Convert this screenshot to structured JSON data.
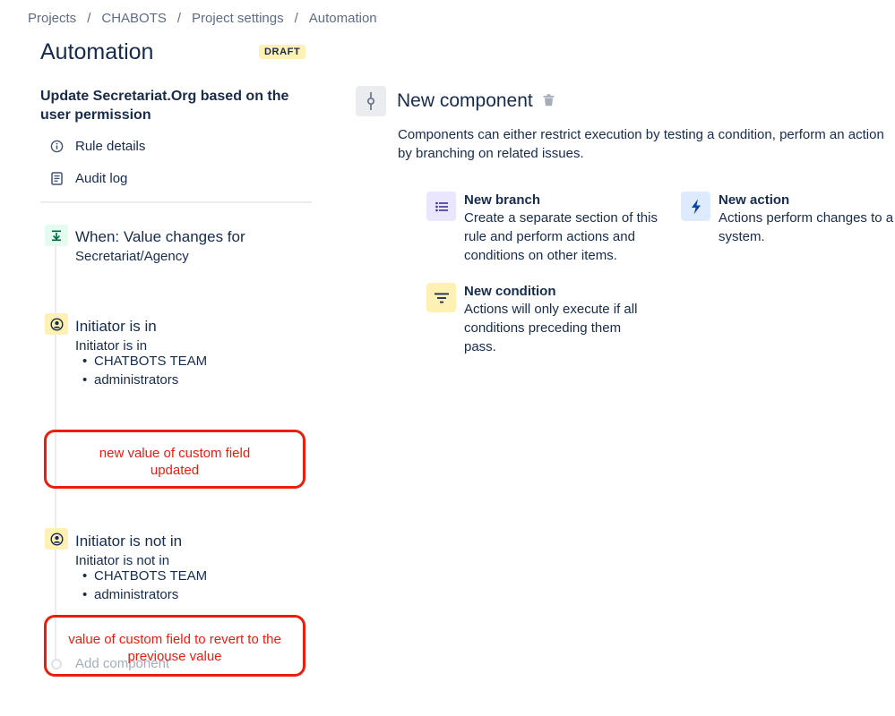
{
  "breadcrumb": [
    "Projects",
    "CHABOTS",
    "Project settings",
    "Automation"
  ],
  "page": {
    "title": "Automation",
    "status_badge": "DRAFT"
  },
  "rule": {
    "name": "Update Secretariat.Org based on the user permission"
  },
  "sidebar_links": [
    {
      "label": "Rule details",
      "icon": "info-icon"
    },
    {
      "label": "Audit log",
      "icon": "document-icon"
    }
  ],
  "steps": {
    "trigger": {
      "title": "When: Value changes for",
      "subtitle": "Secretariat/Agency",
      "icon": "trigger-icon"
    },
    "condition1": {
      "title": "Initiator is in",
      "subtitle": "Initiator is in",
      "items": [
        "CHATBOTS TEAM",
        "administrators"
      ],
      "icon": "user-icon"
    },
    "condition2": {
      "title": "Initiator is not in",
      "subtitle": "Initiator is not in",
      "items": [
        "CHATBOTS TEAM",
        "administrators"
      ],
      "icon": "user-icon"
    }
  },
  "annotations": {
    "first": [
      "new value of custom field",
      "updated"
    ],
    "second": [
      "value of custom field to revert to the",
      "previouse value"
    ]
  },
  "add_component": "Add component",
  "new_component": {
    "title": "New component",
    "description": [
      "Components can either restrict execution by testing a condition, perform an action",
      "by branching on related issues."
    ],
    "options": {
      "branch": {
        "title": "New branch",
        "lines": [
          "Create a separate section of this",
          "rule and perform actions and",
          "conditions on other items."
        ]
      },
      "action": {
        "title": "New action",
        "lines": [
          "Actions perform changes to a",
          "system."
        ]
      },
      "condition": {
        "title": "New condition",
        "lines": [
          "Actions will only execute if all",
          "conditions preceding them",
          "pass."
        ]
      }
    }
  },
  "colors": {
    "annotation": "#ee1c0c",
    "badge": "#fff0b3",
    "text": "#172b4d",
    "muted": "#5e6c84"
  }
}
